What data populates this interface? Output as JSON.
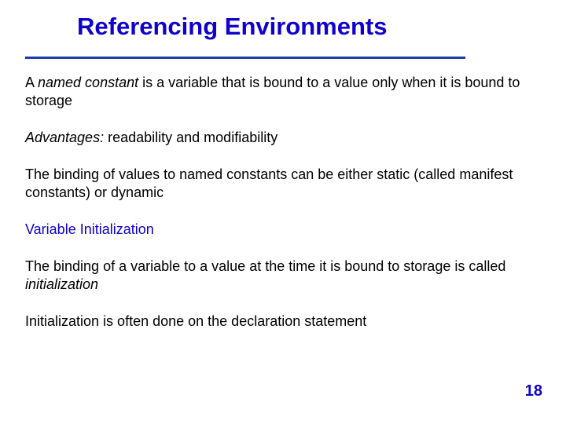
{
  "title": "Referencing Environments",
  "body": {
    "p1": {
      "a": "A ",
      "b": "named constant",
      "c": " is a variable that is bound to a value only when it is bound to storage"
    },
    "p2": {
      "a": "Advantages:",
      "b": " readability and modifiability"
    },
    "p3": "The binding of values to named constants can be either static (called manifest constants) or dynamic",
    "subhead": "Variable Initialization",
    "p4": {
      "a": "The binding of a variable to a value at the time it is bound to storage is called ",
      "b": "initialization"
    },
    "p5": "Initialization is often done on the declaration statement"
  },
  "page_number": "18"
}
